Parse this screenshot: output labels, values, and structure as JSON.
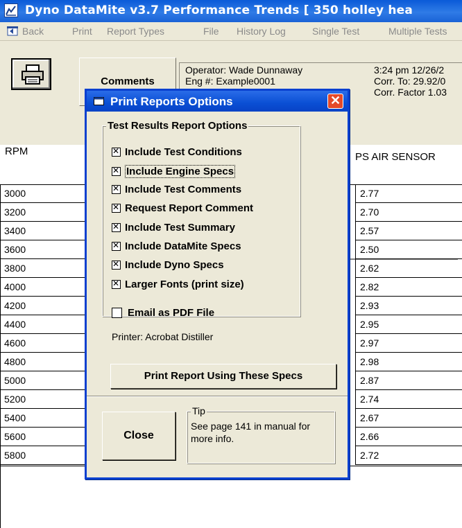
{
  "window": {
    "title": "Dyno DataMite v3.7  Performance Trends  [ 350 holley hea"
  },
  "menu": {
    "items": [
      "Back",
      "Print",
      "Report Types",
      "File",
      "History Log",
      "Single Test",
      "Multiple Tests"
    ]
  },
  "toolbar": {
    "comments_label": "Comments"
  },
  "info": {
    "operator": "Operator: Wade Dunnaway",
    "eng": "Eng #: Example0001",
    "time": "3:24 pm 12/26/2",
    "corr_to": "Corr. To: 29.92/0",
    "corr_factor": "Corr. Factor 1.03"
  },
  "table": {
    "rpm_header": "RPM",
    "air_header": "PS AIR SENSOR",
    "rows": [
      {
        "rpm": "3000",
        "air": "2.77"
      },
      {
        "rpm": "3200",
        "air": "2.70"
      },
      {
        "rpm": "3400",
        "air": "2.57"
      },
      {
        "rpm": "3600",
        "air": "2.50"
      },
      {
        "rpm": "3800",
        "air": "2.62"
      },
      {
        "rpm": "4000",
        "air": "2.82"
      },
      {
        "rpm": "4200",
        "air": "2.93"
      },
      {
        "rpm": "4400",
        "air": "2.95"
      },
      {
        "rpm": "4600",
        "air": "2.97"
      },
      {
        "rpm": "4800",
        "air": "2.98"
      },
      {
        "rpm": "5000",
        "air": "2.87"
      },
      {
        "rpm": "5200",
        "air": "2.74"
      },
      {
        "rpm": "5400",
        "air": "2.67"
      },
      {
        "rpm": "5600",
        "air": "2.66"
      },
      {
        "rpm": "5800",
        "air": "2.72"
      }
    ]
  },
  "dialog": {
    "title": "Print Reports Options",
    "close_glyph": "✕",
    "group_title": "Test Results Report Options",
    "options": [
      {
        "label": "Include Test Conditions",
        "checked": true
      },
      {
        "label": "Include Engine Specs",
        "checked": true
      },
      {
        "label": "Include Test Comments",
        "checked": true
      },
      {
        "label": "Request Report Comment",
        "checked": true
      },
      {
        "label": "Include Test Summary",
        "checked": true
      },
      {
        "label": "Include DataMite Specs",
        "checked": true
      },
      {
        "label": "Include Dyno Specs",
        "checked": true
      },
      {
        "label": "Larger Fonts (print size)",
        "checked": true
      }
    ],
    "email_label": "Email as PDF File",
    "email_checked": false,
    "printer": "Printer: Acrobat Distiller",
    "print_button": "Print Report Using These Specs",
    "close_button": "Close",
    "tip_title": "Tip",
    "tip_text": "See page 141 in manual for more info."
  },
  "colors": {
    "titlebar": "#0a5ad8",
    "dialog_border": "#0840d0",
    "close_red": "#e44a2a",
    "face": "#ece9d8"
  },
  "icons": [
    "app-chart-icon",
    "back-arrow-icon",
    "printer-icon",
    "dialog-window-icon",
    "close-icon"
  ]
}
